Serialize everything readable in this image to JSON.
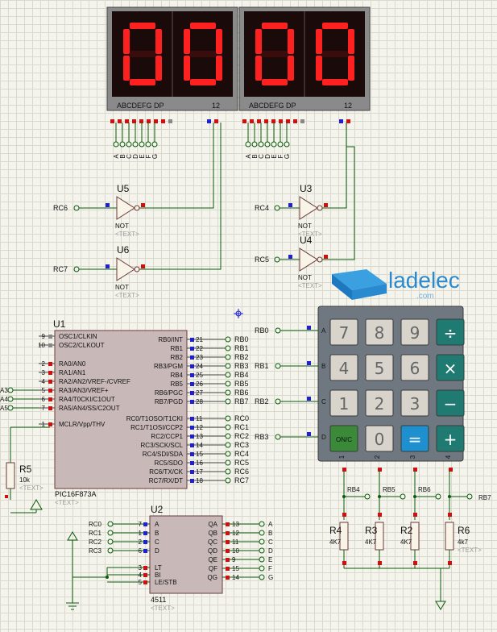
{
  "watermark": {
    "brand": "ladelec",
    "sub": ".com"
  },
  "displays": [
    {
      "digits": [
        "0",
        "0"
      ],
      "segment_label": "ABCDEFG  DP",
      "common_label": "12",
      "pins": [
        "A",
        "B",
        "C",
        "D",
        "E",
        "F",
        "G"
      ]
    },
    {
      "digits": [
        "0",
        "0"
      ],
      "segment_label": "ABCDEFG  DP",
      "common_label": "12",
      "pins": [
        "A",
        "B",
        "C",
        "D",
        "E",
        "F",
        "G"
      ]
    }
  ],
  "gates": [
    {
      "ref": "U5",
      "type": "NOT",
      "text": "<TEXT>",
      "input": "RC6"
    },
    {
      "ref": "U6",
      "type": "NOT",
      "text": "<TEXT>",
      "input": "RC7"
    },
    {
      "ref": "U3",
      "type": "NOT",
      "text": "<TEXT>",
      "input": "RC4"
    },
    {
      "ref": "U4",
      "type": "NOT",
      "text": "<TEXT>",
      "input": "RC5"
    }
  ],
  "mcu": {
    "ref": "U1",
    "part": "PIC16F873A",
    "text": "<TEXT>",
    "left_pins": [
      {
        "num": "9",
        "name": "OSC1/CLKIN"
      },
      {
        "num": "10",
        "name": "OSC2/CLKOUT"
      },
      {
        "num": "2",
        "name": "RA0/AN0"
      },
      {
        "num": "3",
        "name": "RA1/AN1"
      },
      {
        "num": "4",
        "name": "RA2/AN2/VREF-/CVREF"
      },
      {
        "num": "5",
        "name": "RA3/AN3/VREF+"
      },
      {
        "num": "6",
        "name": "RA4/T0CKI/C1OUT"
      },
      {
        "num": "7",
        "name": "RA5/AN4/SS/C2OUT"
      },
      {
        "num": "1",
        "name": "MCLR/Vpp/THV"
      }
    ],
    "left_nets": [
      "A3",
      "A4",
      "A5"
    ],
    "right_pins_b": [
      {
        "num": "21",
        "name": "RB0/INT",
        "net": "RB0"
      },
      {
        "num": "22",
        "name": "RB1",
        "net": "RB1"
      },
      {
        "num": "23",
        "name": "RB2",
        "net": "RB2"
      },
      {
        "num": "24",
        "name": "RB3/PGM",
        "net": "RB3"
      },
      {
        "num": "25",
        "name": "RB4",
        "net": "RB4"
      },
      {
        "num": "26",
        "name": "RB5",
        "net": "RB5"
      },
      {
        "num": "27",
        "name": "RB6/PGC",
        "net": "RB6"
      },
      {
        "num": "28",
        "name": "RB7/PGD",
        "net": "RB7"
      }
    ],
    "right_pins_c": [
      {
        "num": "11",
        "name": "RC0/T1OSO/T1CKI",
        "net": "RC0"
      },
      {
        "num": "12",
        "name": "RC1/T1OSI/CCP2",
        "net": "RC1"
      },
      {
        "num": "13",
        "name": "RC2/CCP1",
        "net": "RC2"
      },
      {
        "num": "14",
        "name": "RC3/SCK/SCL",
        "net": "RC3"
      },
      {
        "num": "15",
        "name": "RC4/SDI/SDA",
        "net": "RC4"
      },
      {
        "num": "16",
        "name": "RC5/SDO",
        "net": "RC5"
      },
      {
        "num": "17",
        "name": "RC6/TX/CK",
        "net": "RC6"
      },
      {
        "num": "18",
        "name": "RC7/RX/DT",
        "net": "RC7"
      }
    ]
  },
  "r5": {
    "ref": "R5",
    "value": "10k",
    "text": "<TEXT>"
  },
  "keypad": {
    "row_nets": [
      "RB0",
      "RB1",
      "RB2",
      "RB3"
    ],
    "row_letters": [
      "A",
      "B",
      "C",
      "D"
    ],
    "col_numbers": [
      "1",
      "2",
      "3",
      "4"
    ],
    "keys": [
      [
        "7",
        "8",
        "9",
        "÷"
      ],
      [
        "4",
        "5",
        "6",
        "×"
      ],
      [
        "1",
        "2",
        "3",
        "−"
      ],
      [
        "ON/C",
        "0",
        "=",
        "+"
      ]
    ]
  },
  "col_nets": [
    "RB4",
    "RB5",
    "RB6",
    "RB7"
  ],
  "resistors": [
    {
      "ref": "R4",
      "value": "4K7"
    },
    {
      "ref": "R3",
      "value": "4K7"
    },
    {
      "ref": "R2",
      "value": "4K7"
    },
    {
      "ref": "R6",
      "value": "4k7",
      "text": "<TEXT>"
    }
  ],
  "decoder": {
    "ref": "U2",
    "part": "4511",
    "text": "<TEXT>",
    "inputs": [
      {
        "net": "RC0",
        "num": "7",
        "name": "A"
      },
      {
        "net": "RC1",
        "num": "1",
        "name": "B"
      },
      {
        "net": "RC2",
        "num": "2",
        "name": "C"
      },
      {
        "net": "RC3",
        "num": "6",
        "name": "D"
      }
    ],
    "ctrl": [
      {
        "num": "3",
        "name": "LT"
      },
      {
        "num": "4",
        "name": "BI"
      },
      {
        "num": "5",
        "name": "LE/STB"
      }
    ],
    "outputs": [
      {
        "num": "13",
        "name": "QA",
        "net": "A"
      },
      {
        "num": "12",
        "name": "QB",
        "net": "B"
      },
      {
        "num": "11",
        "name": "QC",
        "net": "C"
      },
      {
        "num": "10",
        "name": "QD",
        "net": "D"
      },
      {
        "num": "9",
        "name": "QE",
        "net": "E"
      },
      {
        "num": "15",
        "name": "QF",
        "net": "F"
      },
      {
        "num": "14",
        "name": "QG",
        "net": "G"
      }
    ]
  },
  "colors": {
    "wire": "#0a5a0a",
    "pin_red": "#d01010",
    "pin_blue": "#2020d0",
    "chip_body": "#c8b8b8",
    "display_bg": "#1a0a0a",
    "segment_on": "#ff2020",
    "keypad_bg": "#6f7880",
    "key_grey": "#d8d4cc",
    "key_teal": "#1f7a72",
    "key_blue": "#1e8fcf",
    "key_green": "#3a8a3a"
  }
}
